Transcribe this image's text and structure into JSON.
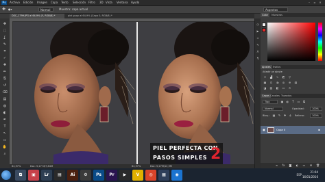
{
  "app": {
    "logo": "Ps"
  },
  "menu": [
    "Archivo",
    "Edición",
    "Imagen",
    "Capa",
    "Texto",
    "Selección",
    "Filtro",
    "3D",
    "Vista",
    "Ventana",
    "Ayuda"
  ],
  "window_controls": [
    "–",
    "▫",
    "×"
  ],
  "options": {
    "sample_label": "Muestra: capa actual",
    "mode_value": "Normal",
    "workspace": "Aspectos esen."
  },
  "doc_tabs": [
    {
      "label": "DSC_1799.JPG al 64,9% (Y, RGB/8) *",
      "active": true
    },
    {
      "label": "piel guay al 64,9% (Capa 0, RGB/8) *",
      "active": false
    }
  ],
  "tools_icons": [
    "move-icon",
    "marquee-icon",
    "lasso-icon",
    "quick-select-icon",
    "crop-icon",
    "eyedropper-icon",
    "healing-icon",
    "brush-icon",
    "stamp-icon",
    "history-brush-icon",
    "eraser-icon",
    "gradient-icon",
    "blur-icon",
    "dodge-icon",
    "pen-icon",
    "type-icon",
    "path-select-icon",
    "shape-icon",
    "hand-icon",
    "zoom-icon"
  ],
  "tool_glyphs": [
    "✥",
    "⬚",
    "ʆ",
    "✎",
    "⌗",
    "✓",
    "✚",
    "✏",
    "⎘",
    "↺",
    "⌫",
    "▤",
    "◍",
    "◐",
    "✒",
    "T",
    "↖",
    "▭",
    "✋",
    "⌕"
  ],
  "caption": {
    "line1": "PIEL PERFECTA CON",
    "line2": "PASOS SIMPLES",
    "number": "2"
  },
  "status": {
    "zoom_left": "64,97%",
    "doc_left": "Doc: 5,27 M/7,84M",
    "zoom_right": "64,97%",
    "doc_right": "Doc: 5,27M/12,9M"
  },
  "panels": {
    "color_tabs": [
      "Color",
      "Muestras"
    ],
    "adjust_tabs": [
      "Ajustes",
      "Estilos"
    ],
    "adjust_title": "Añadir un ajuste",
    "layers_tabs": [
      "Capas",
      "Canales",
      "Trazados"
    ],
    "kind_label": "Tipo",
    "blend_mode": "Normal",
    "opacity_label": "Opacidad:",
    "opacity_value": "100%",
    "lock_label": "Bloq.:",
    "fill_label": "Relleno:",
    "fill_value": "100%",
    "layer_name": "Capa 0"
  },
  "colors": {
    "foreground": "#f0f0f0",
    "background": "#e02a2a",
    "accent_red": "#e0242e"
  },
  "taskbar": {
    "apps": [
      {
        "glyph": "⧉",
        "color": "#3a4a60"
      },
      {
        "glyph": "▣",
        "color": "#c7414a"
      },
      {
        "glyph": "Lr",
        "color": "#2d3e52"
      },
      {
        "glyph": "▤",
        "color": "#2a2a2a"
      },
      {
        "glyph": "Ai",
        "color": "#4a2010"
      },
      {
        "glyph": "⚙",
        "color": "#3a3a3a"
      },
      {
        "glyph": "Ps",
        "color": "#0a4b88"
      },
      {
        "glyph": "Pr",
        "color": "#2a1450"
      },
      {
        "glyph": "▶",
        "color": "#2a2a2a"
      },
      {
        "glyph": "V",
        "color": "#e0b000"
      },
      {
        "glyph": "◎",
        "color": "#d9442a"
      },
      {
        "glyph": "▦",
        "color": "#2f3f5a"
      },
      {
        "glyph": "◉",
        "color": "#1b74d0"
      }
    ],
    "lang": "ESP",
    "time": "21:04",
    "date": "16/01/2016"
  }
}
